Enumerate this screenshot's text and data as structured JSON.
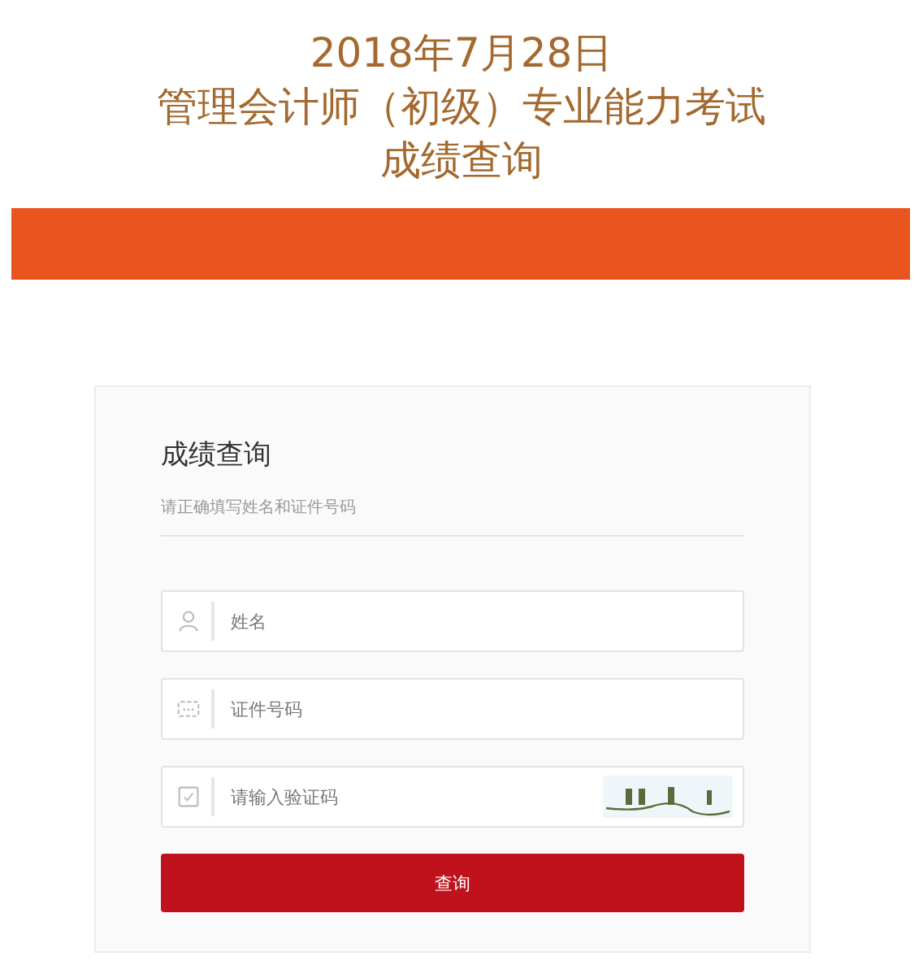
{
  "header": {
    "lines": [
      "2018年7月28日",
      "管理会计师（初级）专业能力考试",
      "成绩查询"
    ]
  },
  "form": {
    "title": "成绩查询",
    "subtitle": "请正确填写姓名和证件号码",
    "fields": [
      {
        "kind": "name",
        "placeholder": "姓名"
      },
      {
        "kind": "id",
        "placeholder": "证件号码"
      },
      {
        "kind": "captcha",
        "placeholder": "请输入验证码"
      }
    ],
    "submit": "查询"
  }
}
